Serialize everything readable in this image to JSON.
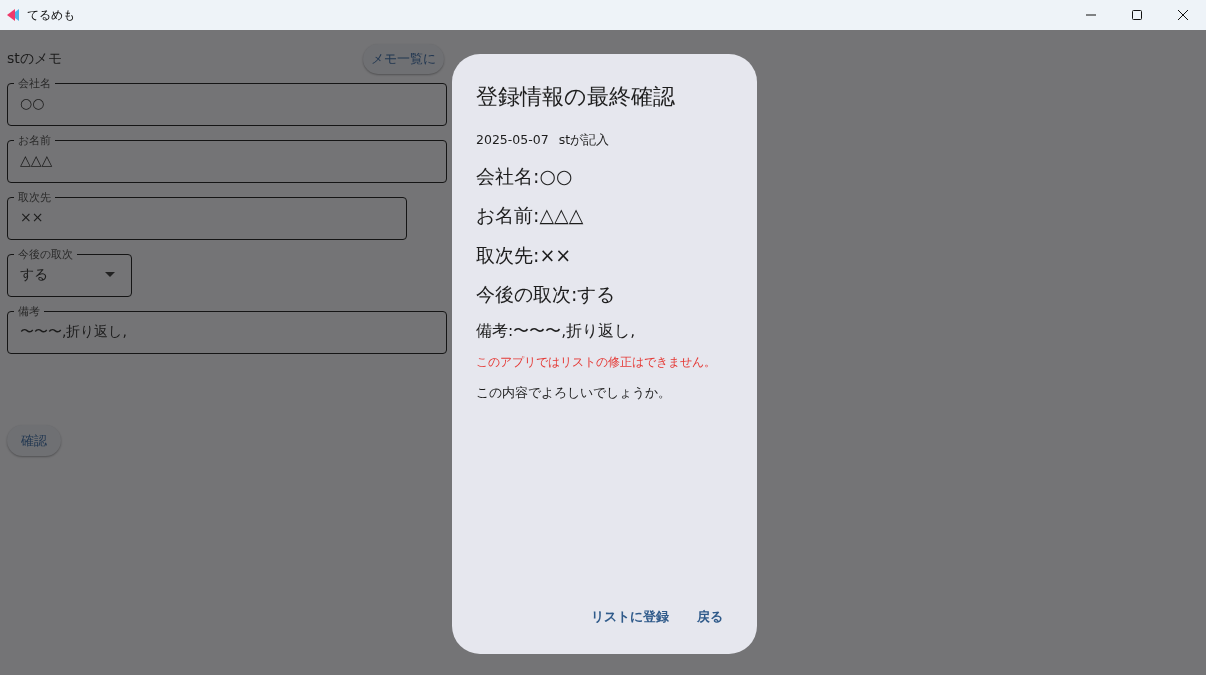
{
  "window": {
    "title": "てるめも"
  },
  "page": {
    "heading": "stのメモ",
    "back_button": "メモ一覧に"
  },
  "fields": [
    {
      "kind": "text",
      "label": "会社名",
      "value": "○○"
    },
    {
      "kind": "text",
      "label": "お名前",
      "value": "△△△"
    },
    {
      "kind": "text",
      "label": "取次先",
      "value": "××"
    },
    {
      "kind": "select",
      "label": "今後の取次",
      "value": "する"
    },
    {
      "kind": "text",
      "label": "備考",
      "value": "〜〜〜,折り返し,"
    }
  ],
  "confirm_button": "確認",
  "dialog": {
    "title": "登録情報の最終確認",
    "date": "2025-05-07",
    "author": "stが記入",
    "lines": [
      {
        "kind": "large",
        "text": "会社名:○○"
      },
      {
        "kind": "large",
        "text": "お名前:△△△"
      },
      {
        "kind": "large",
        "text": "取次先:××"
      },
      {
        "kind": "large",
        "text": "今後の取次:する"
      },
      {
        "kind": "medium",
        "text": "備考:〜〜〜,折り返し,"
      }
    ],
    "warning": "このアプリではリストの修正はできません。",
    "question": "この内容でよろしいでしょうか。",
    "buttons": [
      "リストに登録",
      "戻る"
    ]
  }
}
